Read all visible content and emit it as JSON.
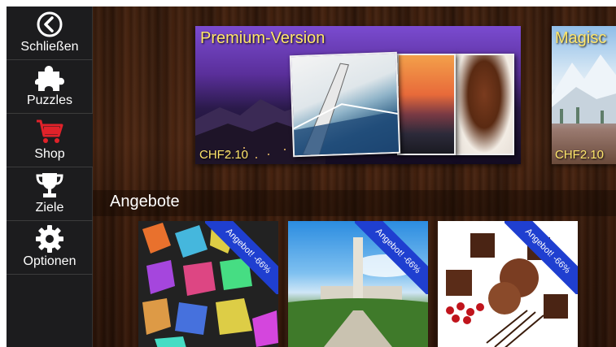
{
  "sidebar": {
    "items": [
      {
        "label": "Schließen",
        "icon": "back-circle-icon"
      },
      {
        "label": "Puzzles",
        "icon": "puzzle-piece-icon"
      },
      {
        "label": "Shop",
        "icon": "cart-icon"
      },
      {
        "label": "Ziele",
        "icon": "trophy-icon"
      },
      {
        "label": "Optionen",
        "icon": "gear-icon"
      }
    ],
    "active_index": 2
  },
  "featured": [
    {
      "title": "Premium-Version",
      "price": "CHF2.10"
    },
    {
      "title": "Magisc",
      "price": "CHF2.10"
    }
  ],
  "offers_section": {
    "title": "Angebote",
    "items": [
      {
        "badge": "Angebot! -66%"
      },
      {
        "badge": "Angebot! -66%"
      },
      {
        "badge": "Angebot! -66%"
      }
    ]
  },
  "colors": {
    "price_text": "#ffe66b",
    "ribbon": "#1f3fd0",
    "shop_icon": "#e0222a",
    "sidebar_bg": "#1c1c1e"
  }
}
